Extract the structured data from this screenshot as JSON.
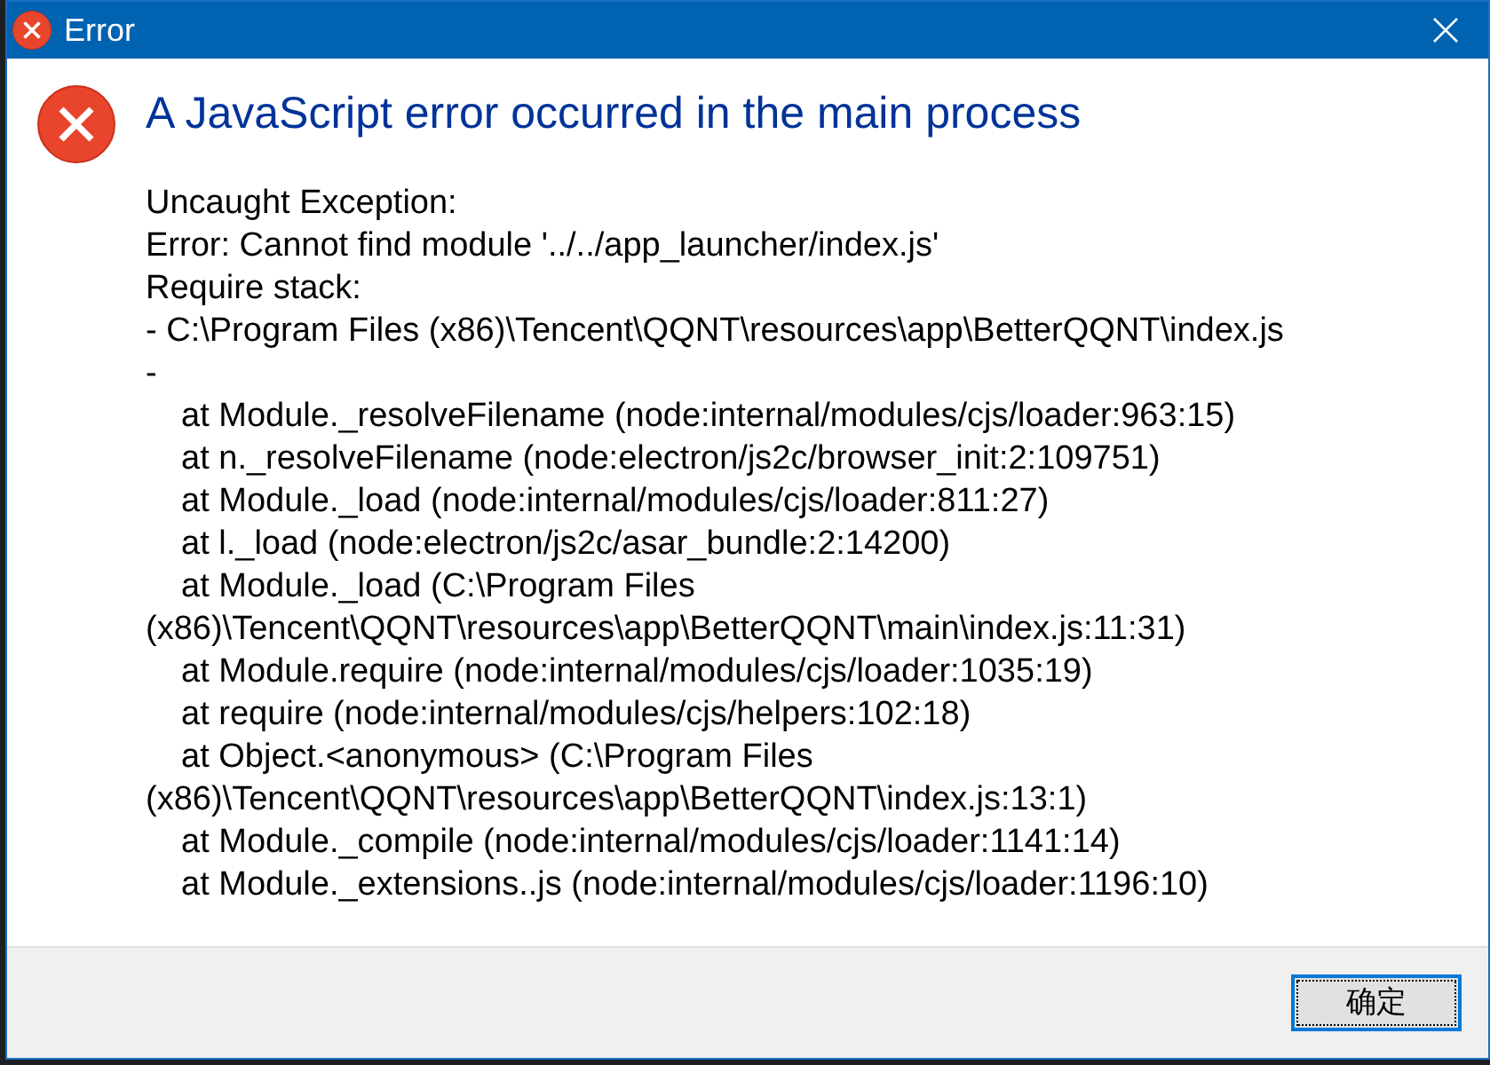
{
  "window": {
    "title": "Error"
  },
  "dialog": {
    "heading": "A JavaScript error occurred in the main process",
    "message_lines": [
      {
        "text": "Uncaught Exception:",
        "indented": false
      },
      {
        "text": "Error: Cannot find module '../../app_launcher/index.js'",
        "indented": false
      },
      {
        "text": "Require stack:",
        "indented": false
      },
      {
        "text": "- C:\\Program Files (x86)\\Tencent\\QQNT\\resources\\app\\BetterQQNT\\index.js",
        "indented": false
      },
      {
        "text": "-",
        "indented": false
      },
      {
        "text": "at Module._resolveFilename (node:internal/modules/cjs/loader:963:15)",
        "indented": true
      },
      {
        "text": "at n._resolveFilename (node:electron/js2c/browser_init:2:109751)",
        "indented": true
      },
      {
        "text": "at Module._load (node:internal/modules/cjs/loader:811:27)",
        "indented": true
      },
      {
        "text": "at l._load (node:electron/js2c/asar_bundle:2:14200)",
        "indented": true
      },
      {
        "text": "at Module._load (C:\\Program Files",
        "indented": true
      },
      {
        "text": "(x86)\\Tencent\\QQNT\\resources\\app\\BetterQQNT\\main\\index.js:11:31)",
        "indented": false
      },
      {
        "text": "at Module.require (node:internal/modules/cjs/loader:1035:19)",
        "indented": true
      },
      {
        "text": "at require (node:internal/modules/cjs/helpers:102:18)",
        "indented": true
      },
      {
        "text": "at Object.<anonymous> (C:\\Program Files",
        "indented": true
      },
      {
        "text": "(x86)\\Tencent\\QQNT\\resources\\app\\BetterQQNT\\index.js:13:1)",
        "indented": false
      },
      {
        "text": "at Module._compile (node:internal/modules/cjs/loader:1141:14)",
        "indented": true
      },
      {
        "text": "at Module._extensions..js (node:internal/modules/cjs/loader:1196:10)",
        "indented": true
      }
    ]
  },
  "buttons": [
    {
      "label": "确定",
      "focused": true
    }
  ]
}
